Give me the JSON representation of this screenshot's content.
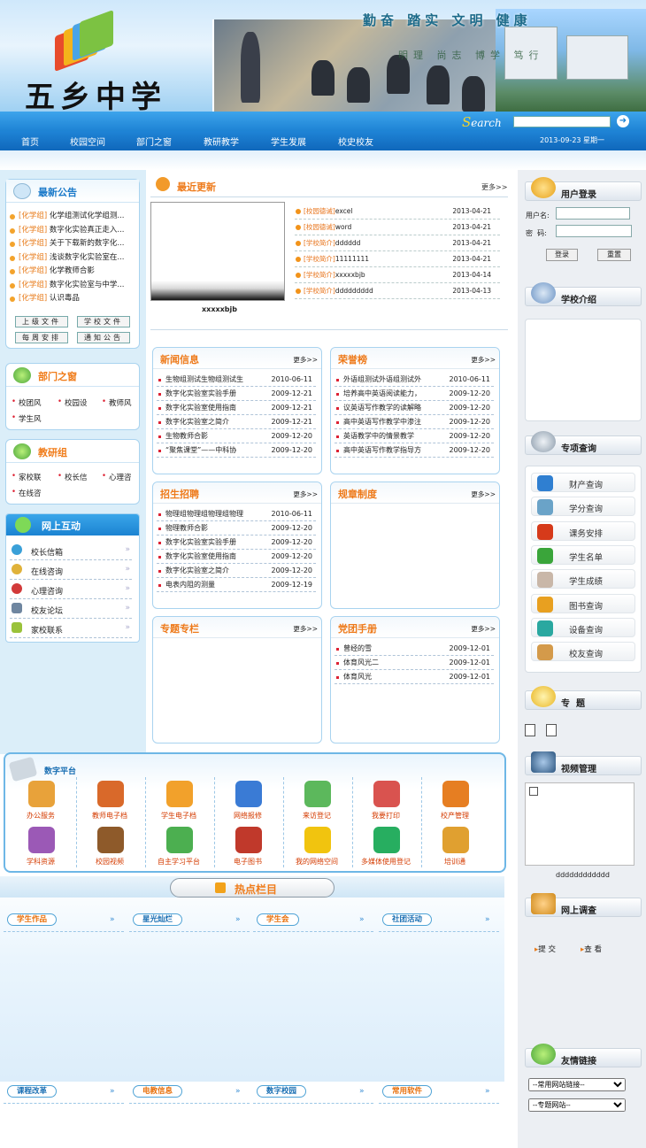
{
  "header": {
    "school_name": "五乡中学",
    "slogan": "勤奋 踏实 文明 健康",
    "slogan2": "明理 尚志 博学 笃行",
    "search_label": "Search",
    "date_text": "2013-09-23 星期一"
  },
  "nav": [
    "首页",
    "校园空间",
    "部门之窗",
    "教研教学",
    "学生发展",
    "校史校友"
  ],
  "latest_notice": {
    "title": "最新公告",
    "items": [
      {
        "tag": "[化学组]",
        "text": "化学组测试化学组测..."
      },
      {
        "tag": "[化学组]",
        "text": "数字化实验真正走入..."
      },
      {
        "tag": "[化学组]",
        "text": "关于下载新的数字化..."
      },
      {
        "tag": "[化学组]",
        "text": "浅谈数字化实验室在..."
      },
      {
        "tag": "[化学组]",
        "text": "化学教师合影"
      },
      {
        "tag": "[化学组]",
        "text": "数字化实验室与中学..."
      },
      {
        "tag": "[化学组]",
        "text": "认识毒品"
      }
    ],
    "buttons": [
      "上级文件",
      "学校文件",
      "每周安排",
      "通知公告"
    ]
  },
  "dept": {
    "title": "部门之窗",
    "items": [
      "校团风",
      "校园设",
      "教师风",
      "学生风"
    ]
  },
  "research": {
    "title": "教研组",
    "items": [
      "家校联",
      "校长信",
      "心理咨",
      "在线咨"
    ]
  },
  "interact": {
    "title": "网上互动",
    "items": [
      "校长信箱",
      "在线咨询",
      "心理咨询",
      "校友论坛",
      "家校联系"
    ]
  },
  "latest_update": {
    "title": "最近更新",
    "more": "更多>>",
    "image_caption": "xxxxxbjb",
    "items": [
      {
        "tag": "[校园德诫]",
        "text": "excel",
        "date": "2013-04-21"
      },
      {
        "tag": "[校园德诫]",
        "text": "word",
        "date": "2013-04-21"
      },
      {
        "tag": "[学校简介]",
        "text": "dddddd",
        "date": "2013-04-21"
      },
      {
        "tag": "[学校简介]",
        "text": "11111111",
        "date": "2013-04-21"
      },
      {
        "tag": "[学校简介]",
        "text": "xxxxxbjb",
        "date": "2013-04-14"
      },
      {
        "tag": "[学校简介]",
        "text": "ddddddddd",
        "date": "2013-04-13"
      }
    ]
  },
  "panels": [
    {
      "title": "新闻信息",
      "more": "更多>>",
      "items": [
        {
          "text": "生物组测试生物组测试生",
          "date": "2010-06-11"
        },
        {
          "text": "数字化实验室实验手册",
          "date": "2009-12-21"
        },
        {
          "text": "数字化实验室使用指南",
          "date": "2009-12-21"
        },
        {
          "text": "数字化实验室之简介",
          "date": "2009-12-21"
        },
        {
          "text": "生物教师合影",
          "date": "2009-12-20"
        },
        {
          "text": "“聚焦课堂”——中科协",
          "date": "2009-12-20"
        }
      ]
    },
    {
      "title": "荣誉榜",
      "more": "更多>>",
      "items": [
        {
          "text": "外语组测试外语组测试外",
          "date": "2010-06-11"
        },
        {
          "text": "培养高中英语阅读能力，",
          "date": "2009-12-20"
        },
        {
          "text": "议英语写作教学的读解略",
          "date": "2009-12-20"
        },
        {
          "text": "高中英语写作教学中渗注",
          "date": "2009-12-20"
        },
        {
          "text": "英语教学中的情景教学",
          "date": "2009-12-20"
        },
        {
          "text": "高中英语写作教学指导方",
          "date": "2009-12-20"
        }
      ]
    },
    {
      "title": "招生招聘",
      "more": "更多>>",
      "items": [
        {
          "text": "物理组物理组物理组物理",
          "date": "2010-06-11"
        },
        {
          "text": "物理教师合影",
          "date": "2009-12-20"
        },
        {
          "text": "数字化实验室实验手册",
          "date": "2009-12-20"
        },
        {
          "text": "数字化实验室使用指南",
          "date": "2009-12-20"
        },
        {
          "text": "数字化实验室之简介",
          "date": "2009-12-20"
        },
        {
          "text": "电表内阻的测量",
          "date": "2009-12-19"
        }
      ]
    },
    {
      "title": "规章制度",
      "more": "更多>>",
      "items": []
    },
    {
      "title": "专题专栏",
      "more": "更多>>",
      "items": []
    },
    {
      "title": "党团手册",
      "more": "更多>>",
      "items": [
        {
          "text": "曾经的雪",
          "date": "2009-12-01"
        },
        {
          "text": "体育风光二",
          "date": "2009-12-01"
        },
        {
          "text": "体育风光",
          "date": "2009-12-01"
        }
      ]
    }
  ],
  "digital_platform": {
    "title": "数字平台",
    "tiles": [
      "办公服务",
      "教师电子档",
      "学生电子档",
      "网络报修",
      "来访登记",
      "我要打印",
      "校产管理",
      "学科资源",
      "校园视频",
      "自主学习平台",
      "电子图书",
      "我的网络空间",
      "多媒体使用登记",
      "培训通"
    ],
    "colors": [
      "#e8a23a",
      "#d9692a",
      "#f2a12b",
      "#3a7bd5",
      "#5cb85c",
      "#d9534f",
      "#e67e22",
      "#9b59b6",
      "#8e5a2a",
      "#4caf50",
      "#c0392b",
      "#f1c40f",
      "#27ae60",
      "#e0a030"
    ]
  },
  "hot_column": {
    "title": "热点栏目",
    "row1": [
      "学生作品",
      "星光灿烂",
      "学生会",
      "社团活动"
    ],
    "row2": [
      "课程改革",
      "电教信息",
      "数字校园",
      "常用软件"
    ]
  },
  "login": {
    "title": "用户登录",
    "user_label": "用户名:",
    "pass_label": "密  码:",
    "login_btn": "登录",
    "reset_btn": "重置"
  },
  "school_intro": {
    "title": "学校介绍"
  },
  "special_query": {
    "title": "专项查询",
    "items": [
      "财产查询",
      "学分查询",
      "课务安排",
      "学生名单",
      "学生成绩",
      "图书查询",
      "设备查询",
      "校友查询"
    ]
  },
  "topic": {
    "title": "专  题"
  },
  "video": {
    "title": "视频管理",
    "caption": "dddddddddddd"
  },
  "survey": {
    "title": "网上调查",
    "submit": "提 交",
    "view": "查 看"
  },
  "links": {
    "title": "友情链接",
    "select1": "--常用网站链接--",
    "select2": "--专题网站--"
  }
}
